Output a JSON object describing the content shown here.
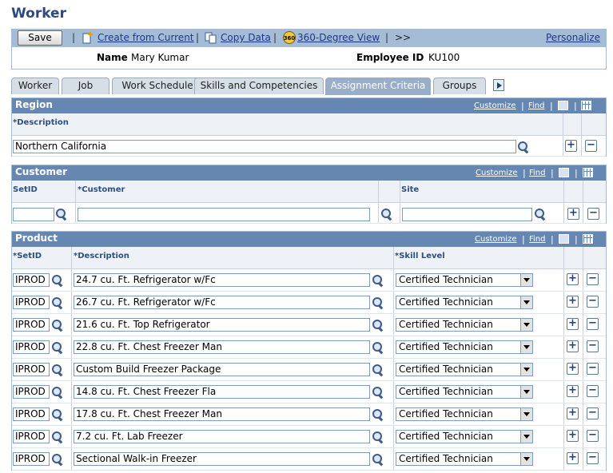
{
  "page": {
    "title": "Worker"
  },
  "toolbar": {
    "save_label": "Save",
    "create_label": "Create from Current",
    "copy_label": "Copy Data",
    "view360_label": "360-Degree View",
    "view360_icon_text": "360",
    "more_label": ">>",
    "personalize_label": "Personalize"
  },
  "info": {
    "name_label": "Name",
    "name_value": "Mary Kumar",
    "empid_label": "Employee ID",
    "empid_value": "KU100"
  },
  "tabs": [
    {
      "label": "Worker"
    },
    {
      "label": "Job"
    },
    {
      "label": "Work Schedule"
    },
    {
      "label": "Skills and Competencies"
    },
    {
      "label": "Assignment Criteria"
    },
    {
      "label": "Groups"
    }
  ],
  "grid_controls": {
    "customize": "Customize",
    "find": "Find",
    "sep": "|"
  },
  "region": {
    "title": "Region",
    "col_description": "*Description",
    "description_value": "Northern California"
  },
  "customer": {
    "title": "Customer",
    "col_setid": "SetID",
    "col_customer": "*Customer",
    "col_site": "Site",
    "setid_value": "",
    "customer_value": "",
    "site_value": ""
  },
  "product": {
    "title": "Product",
    "col_setid": "*SetID",
    "col_description": "*Description",
    "col_skill": "*Skill Level",
    "rows": [
      {
        "setid": "IPROD",
        "description": "24.7 cu. Ft. Refrigerator w/Fc",
        "skill": "Certified Technician"
      },
      {
        "setid": "IPROD",
        "description": "26.7 cu. Ft. Refrigerator w/Fc",
        "skill": "Certified Technician"
      },
      {
        "setid": "IPROD",
        "description": "21.6 cu. Ft. Top Refrigerator",
        "skill": "Certified Technician"
      },
      {
        "setid": "IPROD",
        "description": "22.8 cu. Ft. Chest Freezer Man",
        "skill": "Certified Technician"
      },
      {
        "setid": "IPROD",
        "description": "Custom Build Freezer Package",
        "skill": "Certified Technician"
      },
      {
        "setid": "IPROD",
        "description": "14.8 cu. Ft. Chest Freezer Fla",
        "skill": "Certified Technician"
      },
      {
        "setid": "IPROD",
        "description": "17.8 cu. Ft. Chest Freezer Man",
        "skill": "Certified Technician"
      },
      {
        "setid": "IPROD",
        "description": "7.2 cu. Ft. Lab Freezer",
        "skill": "Certified Technician"
      },
      {
        "setid": "IPROD",
        "description": "Sectional Walk-in Freezer",
        "skill": "Certified Technician"
      }
    ]
  },
  "buttons": {
    "add": "+",
    "remove": "−"
  }
}
